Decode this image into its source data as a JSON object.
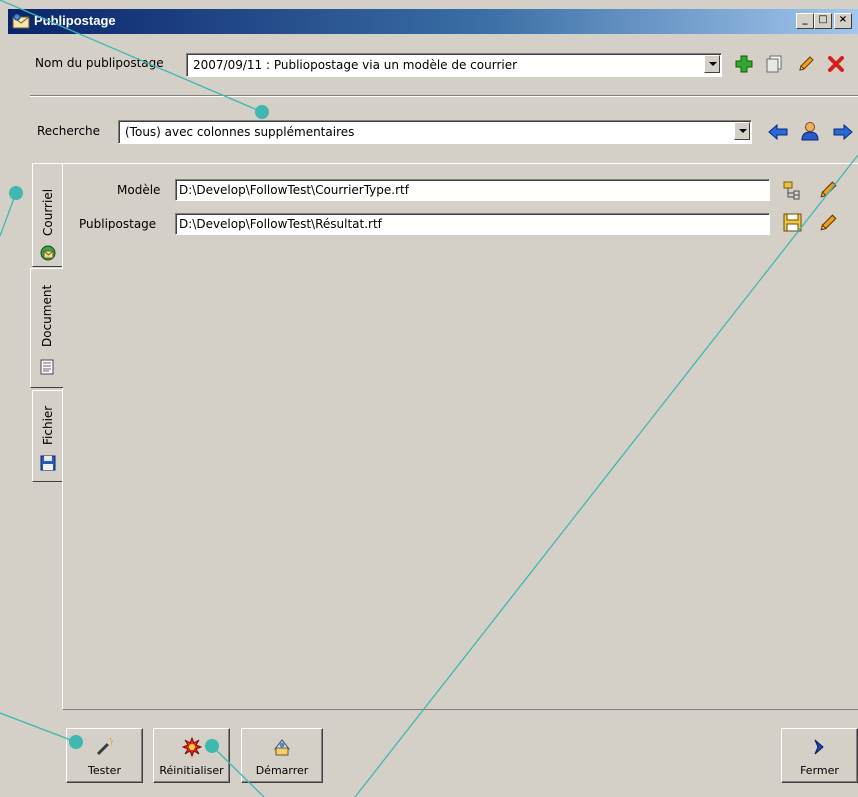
{
  "window": {
    "title": "Publipostage",
    "minimize_glyph": "_",
    "maximize_glyph": "□",
    "close_glyph": "×"
  },
  "header": {
    "name_label": "Nom du publipostage",
    "name_value": "2007/09/11 : Publiopostage via un modèle de courrier",
    "search_label": "Recherche",
    "search_value": "(Tous) avec colonnes supplémentaires"
  },
  "tabs": [
    {
      "label": "Courriel",
      "icon": "globe-mail-icon"
    },
    {
      "label": "Document",
      "icon": "document-icon"
    },
    {
      "label": "Fichier",
      "icon": "floppy-icon"
    }
  ],
  "document": {
    "model_label": "Modèle",
    "model_value": "D:\\Develop\\FollowTest\\CourrierType.rtf",
    "output_label": "Publipostage",
    "output_value": "D:\\Develop\\FollowTest\\Résultat.rtf"
  },
  "buttons": {
    "test": "Tester",
    "reset": "Réinitialiser",
    "start": "Démarrer",
    "close": "Fermer"
  },
  "colors": {
    "window_bg": "#d4d0c8",
    "title_gradient_start": "#0a246a",
    "title_gradient_end": "#a6caf0",
    "annotation": "#3fb8b0"
  }
}
